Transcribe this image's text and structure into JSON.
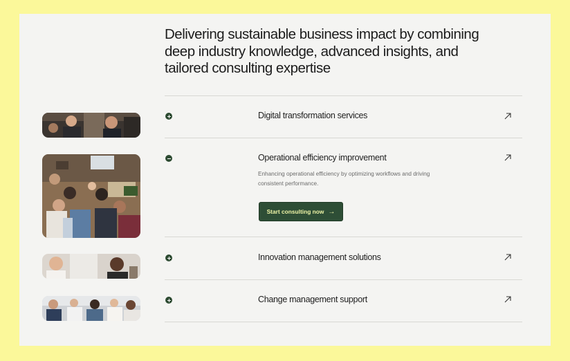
{
  "headline": "Delivering sustainable business impact by combining deep industry knowledge, advanced insights, and tailored consulting expertise",
  "services": [
    {
      "title": "Digital transformation services",
      "expanded": false
    },
    {
      "title": "Operational efficiency improvement",
      "expanded": true,
      "description": "Enhancing operational efficiency by optimizing workflows and driving consistent performance.",
      "cta_label": "Start consulting now",
      "cta_icon": "arrow-right-icon"
    },
    {
      "title": "Innovation management solutions",
      "expanded": false
    },
    {
      "title": "Change management support",
      "expanded": false
    }
  ],
  "icons": {
    "expand": "plus-circle-icon",
    "collapse": "minus-circle-icon",
    "open": "arrow-up-right-icon"
  },
  "colors": {
    "page_background": "#fbf89a",
    "panel": "#f4f4f2",
    "accent": "#2e4e36",
    "cta_text": "#eef4a6"
  }
}
